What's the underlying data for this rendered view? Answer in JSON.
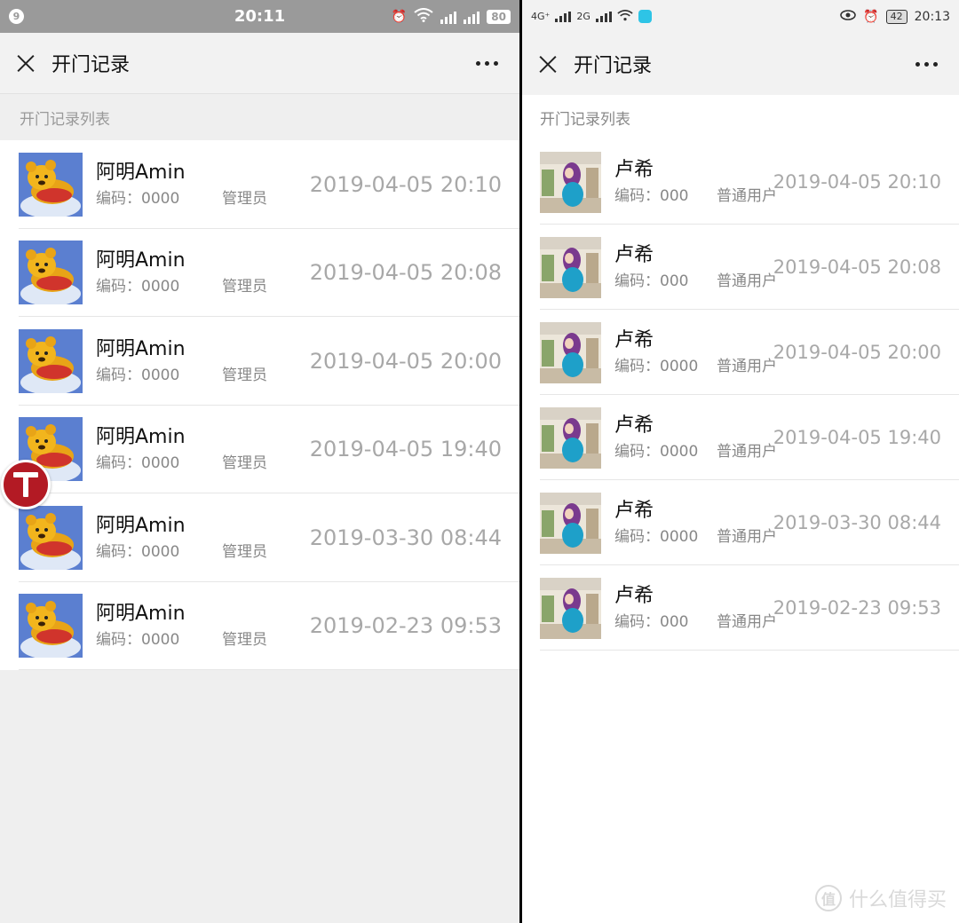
{
  "left": {
    "status": {
      "notification_count": "9",
      "time": "20:11",
      "battery": "80"
    },
    "title": "开门记录",
    "section_header": "开门记录列表",
    "records": [
      {
        "name": "阿明Amin",
        "code_label": "编码：",
        "code": "0000",
        "role": "管理员",
        "time": "2019-04-05 20:10"
      },
      {
        "name": "阿明Amin",
        "code_label": "编码：",
        "code": "0000",
        "role": "管理员",
        "time": "2019-04-05 20:08"
      },
      {
        "name": "阿明Amin",
        "code_label": "编码：",
        "code": "0000",
        "role": "管理员",
        "time": "2019-04-05 20:00"
      },
      {
        "name": "阿明Amin",
        "code_label": "编码：",
        "code": "0000",
        "role": "管理员",
        "time": "2019-04-05 19:40"
      },
      {
        "name": "阿明Amin",
        "code_label": "编码：",
        "code": "0000",
        "role": "管理员",
        "time": "2019-03-30 08:44"
      },
      {
        "name": "阿明Amin",
        "code_label": "编码：",
        "code": "0000",
        "role": "管理员",
        "time": "2019-02-23 09:53"
      }
    ]
  },
  "right": {
    "status": {
      "net1": "4G⁺",
      "net2": "2G",
      "time": "20:13",
      "battery": "42"
    },
    "title": "开门记录",
    "section_header": "开门记录列表",
    "records": [
      {
        "name": "卢希",
        "code_label": "编码：",
        "code": "000",
        "role": "普通用户",
        "time": "2019-04-05 20:10"
      },
      {
        "name": "卢希",
        "code_label": "编码：",
        "code": "000",
        "role": "普通用户",
        "time": "2019-04-05 20:08"
      },
      {
        "name": "卢希",
        "code_label": "编码：",
        "code": "0000",
        "role": "普通用户",
        "time": "2019-04-05 20:00"
      },
      {
        "name": "卢希",
        "code_label": "编码：",
        "code": "0000",
        "role": "普通用户",
        "time": "2019-04-05 19:40"
      },
      {
        "name": "卢希",
        "code_label": "编码：",
        "code": "0000",
        "role": "普通用户",
        "time": "2019-03-30 08:44"
      },
      {
        "name": "卢希",
        "code_label": "编码：",
        "code": "000",
        "role": "普通用户",
        "time": "2019-02-23 09:53"
      }
    ]
  },
  "floating_badge": {
    "letter": "T",
    "color": "#b31a24"
  },
  "watermark": {
    "icon": "值",
    "text": "什么值得买"
  }
}
